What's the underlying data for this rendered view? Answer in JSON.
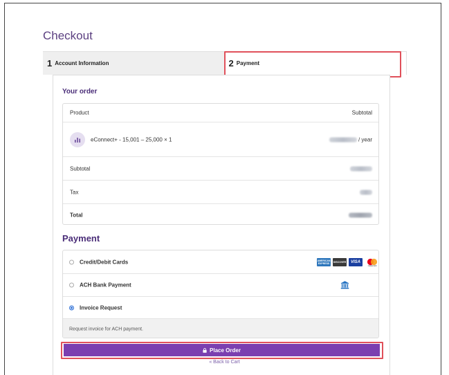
{
  "page": {
    "title": "Checkout"
  },
  "steps": [
    {
      "num": "1",
      "label": "Account Information"
    },
    {
      "num": "2",
      "label": "Payment"
    }
  ],
  "order": {
    "heading": "Your order",
    "col_product": "Product",
    "col_subtotal": "Subtotal",
    "product_name": "eConnect+ - 15,001 – 25,000 × 1",
    "price_suffix": "/ year",
    "subtotal_label": "Subtotal",
    "tax_label": "Tax",
    "total_label": "Total"
  },
  "payment": {
    "heading": "Payment",
    "options": [
      {
        "label": "Credit/Debit Cards",
        "selected": false
      },
      {
        "label": "ACH Bank Payment",
        "selected": false
      },
      {
        "label": "Invoice Request",
        "selected": true
      }
    ],
    "note": "Request invoice for ACH payment.",
    "cards": [
      "AMERICAN EXPRESS",
      "DISCOVER",
      "VISA",
      "mastercard"
    ],
    "icons": [
      "product-chart-icon",
      "bank-icon",
      "lock-icon"
    ]
  },
  "actions": {
    "place_order": "Place Order",
    "back_to_cart": "« Back to Cart"
  },
  "colors": {
    "accent": "#7b3fb0",
    "heading": "#4a2d78",
    "highlight": "#e0505a",
    "radio_selected": "#2d6fd6"
  }
}
